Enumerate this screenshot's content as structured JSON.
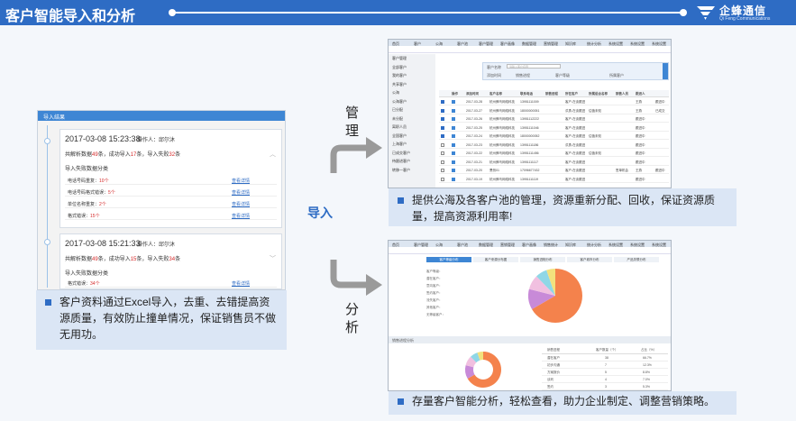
{
  "header": {
    "title": "客户智能导入和分析"
  },
  "brand": {
    "name": "企蜂通信",
    "sub": "Qi Feng Communications"
  },
  "labels": {
    "manage": "管理",
    "analyze": "分析",
    "import": "导入"
  },
  "captions": {
    "manage": "提供公海及各客户池的管理，资源重新分配、回收，保证资源质量，提高资源利用率!",
    "import": "客户资料通过Excel导入，去重、去错提高资源质量，有效防止撞单情况，保证销售员不做无用功。",
    "analyze": "存量客户智能分析，轻松查看，助力企业制定、调整营销策略。"
  },
  "import_log": {
    "title": "导入结果",
    "entries": [
      {
        "datetime": "2017-03-08 15:23:38",
        "operator": "操作人：邱尔沐",
        "parse_prefix": "共解析数据",
        "parse_total": "49",
        "parse_mid1": "条，成功导入",
        "success": "17",
        "parse_mid2": "条，导入失败",
        "failed": "32",
        "parse_suffix": "条",
        "fail_title": "导入失败数据分类",
        "rows": [
          {
            "label": "电话号码重复：",
            "count": "10个",
            "link": "查看详情"
          },
          {
            "label": "电话号码格式错误：",
            "count": "5个",
            "link": "查看详情"
          },
          {
            "label": "单位名称重复：",
            "count": "2个",
            "link": "查看详情"
          },
          {
            "label": "格式错误：",
            "count": "15个",
            "link": "查看详情"
          }
        ]
      },
      {
        "datetime": "2017-03-08 15:21:33",
        "operator": "操作人：邱尔沐",
        "parse_prefix": "共解析数据",
        "parse_total": "49",
        "parse_mid1": "条，成功导入",
        "success": "15",
        "parse_mid2": "条，导入失败",
        "failed": "34",
        "parse_suffix": "条",
        "fail_title": "导入失败数据分类",
        "rows": [
          {
            "label": "格式错误：",
            "count": "34个",
            "link": "查看详情"
          }
        ]
      }
    ]
  },
  "manage_shot": {
    "nav": [
      "首页",
      "客户",
      "公海",
      "客户池",
      "客户管理",
      "客户画像",
      "数据管理",
      "营销管理",
      "知识库",
      "统计分析",
      "系统设置",
      "系统设置",
      "系统设置"
    ],
    "side": [
      "客户管理",
      "全部客户",
      "我的客户",
      "共享客户",
      "公海",
      "公海客户",
      "已分配",
      "未分配",
      "离职人员",
      "全国客户",
      "上海客户",
      "已成交客户",
      "待跟进客户",
      "转移一客户"
    ],
    "search_label": "客户名称",
    "search_placeholder": "请输入客户名称",
    "filters": [
      "添加时间",
      "销售进程",
      "客户等级",
      "所属客户"
    ],
    "table_headers": [
      "",
      "操作",
      "添加时间",
      "客户名称",
      "联系电话",
      "销售进程",
      "所在客户",
      "所属组合名称",
      "销售人员",
      "跟进人"
    ],
    "rows": [
      [
        "2017-03-28",
        "杭州蜂鸟网络科技",
        "13951111009",
        "",
        "客户-在谈跟进",
        "",
        "",
        "王燕",
        "跟进中"
      ],
      [
        "2017-03-27",
        "杭州蜂鸟网络科技",
        "18000000051",
        "",
        "洪勇-在谈跟进",
        "估值未知",
        "",
        "王燕",
        "已成交"
      ],
      [
        "2017-03-26",
        "杭州蜂鸟网络科技",
        "13951112222",
        "",
        "客户-在谈跟进",
        "",
        "",
        "跟进中",
        ""
      ],
      [
        "2017-03-25",
        "杭州蜂鸟网络科技",
        "13951111046",
        "",
        "客户-在谈跟进",
        "",
        "",
        "跟进中",
        ""
      ],
      [
        "2017-03-24",
        "杭州蜂鸟网络科技",
        "18000000052",
        "",
        "客户-在谈跟进",
        "估值未知",
        "",
        "跟进中",
        ""
      ],
      [
        "2017-03-23",
        "杭州蜂鸟网络科技",
        "13951111186",
        "",
        "洪勇-在谈跟进",
        "",
        "",
        "跟进中",
        ""
      ],
      [
        "2017-03-22",
        "杭州蜂鸟网络科技",
        "13951111456",
        "",
        "客户-在谈跟进",
        "估值未知",
        "",
        "跟进中",
        ""
      ],
      [
        "2017-03-21",
        "杭州蜂鸟网络科技",
        "13951111117",
        "",
        "客户-在谈跟进",
        "",
        "",
        "跟进中",
        ""
      ],
      [
        "2017-03-20",
        "萧然01",
        "17096677432",
        "",
        "客户-在谈跟进",
        "",
        "签单机会",
        "王燕",
        "跟进中"
      ],
      [
        "2017-03-19",
        "杭州蜂鸟网络科技",
        "13951111119",
        "",
        "客户-在谈跟进",
        "",
        "",
        "跟进中",
        ""
      ]
    ]
  },
  "analyze_shot": {
    "nav": [
      "首页",
      "客户管理",
      "公海",
      "客户池",
      "数据管理",
      "营销管理",
      "客户画像",
      "销售统计",
      "知识库",
      "统计分析",
      "系统设置",
      "系统设置",
      "系统设置"
    ],
    "tabs": [
      "客户等级分布",
      "客户来源分布图",
      "销售进程分布",
      "客户城市分布",
      "产品关联分布"
    ],
    "section": "销售进程分析",
    "table_headers": [
      "销售进程",
      "客户数量（个）",
      "占比（%）"
    ],
    "table_rows": [
      [
        "潜在客户",
        "38",
        "66.7%"
      ],
      [
        "初步沟通",
        "7",
        "12.3%"
      ],
      [
        "方案报价",
        "5",
        "8.8%"
      ],
      [
        "谈判",
        "4",
        "7.0%"
      ],
      [
        "签约",
        "3",
        "5.3%"
      ]
    ]
  },
  "chart_data": {
    "type": "pie",
    "slices": [
      {
        "label": "潜在客户",
        "value": 66.7,
        "color": "#f4824c"
      },
      {
        "label": "初步沟通",
        "value": 12.3,
        "color": "#c88ad8"
      },
      {
        "label": "方案报价",
        "value": 8.8,
        "color": "#f1c0e0"
      },
      {
        "label": "谈判",
        "value": 7.0,
        "color": "#8fd7e6"
      },
      {
        "label": "签约",
        "value": 5.3,
        "color": "#f2e17d"
      }
    ]
  }
}
